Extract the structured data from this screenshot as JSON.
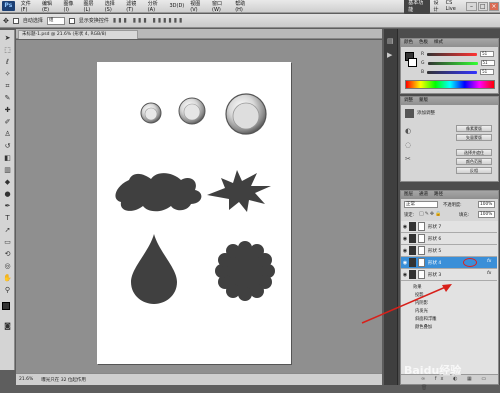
{
  "menubar": {
    "logo": "Ps",
    "items": [
      "文件(F)",
      "编辑(E)",
      "图像(I)",
      "图层(L)",
      "选择(S)",
      "滤镜(T)",
      "分析(A)",
      "3D(D)",
      "视图(V)",
      "窗口(W)",
      "帮助(H)"
    ],
    "zoom": "21.6",
    "workspace_active": "基本功能",
    "workspace_other": "设计",
    "cs_live": "CS Live"
  },
  "options": {
    "auto_select": "自动选择",
    "auto_select_value": "组",
    "show_transform": "显示变换控件"
  },
  "document": {
    "tab_title": "未标题-1.psd @ 21.6% (形状 4, RGB/8)",
    "zoom_status": "21.6%",
    "status_text": "曝光只在 32 位起作用"
  },
  "color_panel": {
    "header_tabs": [
      "颜色",
      "色板",
      "样式"
    ],
    "r": "51",
    "g": "51",
    "b": "51",
    "r_label": "R",
    "g_label": "G",
    "b_label": "B",
    "accent": "#333333"
  },
  "adjust_panel": {
    "header_tabs": [
      "调整",
      "蒙版"
    ],
    "title": "添加调整",
    "buttons": [
      "像素蒙版",
      "矢量蒙版",
      "选择并遮住",
      "颜色范围",
      "反相"
    ]
  },
  "layers_panel": {
    "header_tabs": [
      "图层",
      "通道",
      "路径"
    ],
    "blend_mode": "正常",
    "opacity_label": "不透明度:",
    "opacity_value": "100%",
    "lock_label": "锁定:",
    "fill_label": "填充:",
    "fill_value": "100%",
    "layers": [
      {
        "name": "形状 7",
        "selected": false
      },
      {
        "name": "形状 6",
        "selected": false
      },
      {
        "name": "形状 5",
        "selected": false
      },
      {
        "name": "形状 4",
        "selected": true
      },
      {
        "name": "形状 3",
        "selected": false
      }
    ],
    "effects_label": "效果",
    "effects": [
      "投影",
      "内阴影",
      "内发光",
      "斜面和浮雕",
      "颜色叠加"
    ],
    "fx_badge": "fx",
    "selected_color": "#3a8fd8"
  },
  "watermark": "Baidu经验"
}
